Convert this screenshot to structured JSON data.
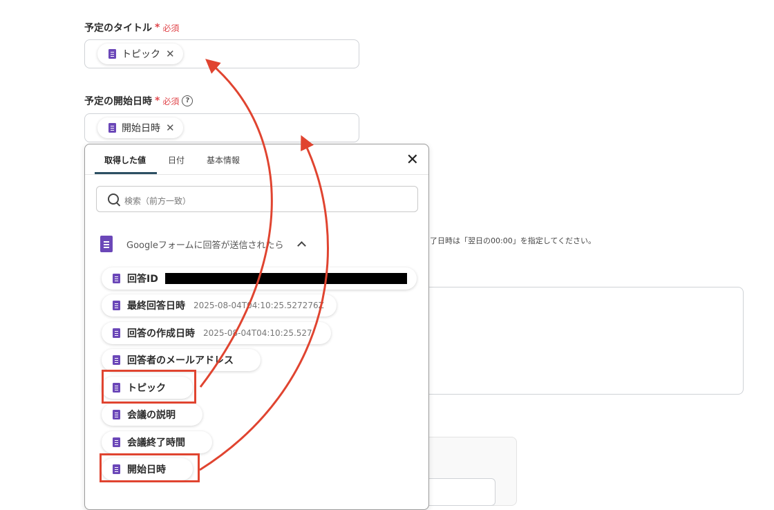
{
  "fields": {
    "title_label": "予定のタイトル",
    "title_required": "必須",
    "title_chip": "トピック",
    "start_label": "予定の開始日時",
    "start_required": "必須",
    "start_chip": "開始日時",
    "help_glyph": "?"
  },
  "popup": {
    "tabs": [
      "取得した値",
      "日付",
      "基本情報"
    ],
    "search_placeholder": "検索（前方一致）",
    "group_title": "Googleフォームに回答が送信されたら",
    "items": [
      {
        "label": "回答ID",
        "value": ""
      },
      {
        "label": "最終回答日時",
        "value": "2025-08-04T04:10:25.527276Z"
      },
      {
        "label": "回答の作成日時",
        "value": "2025-08-04T04:10:25.527"
      },
      {
        "label": "回答者のメールアドレス",
        "value": ""
      },
      {
        "label": "トピック",
        "value": ""
      },
      {
        "label": "会議の説明",
        "value": ""
      },
      {
        "label": "会議終了時間",
        "value": ""
      },
      {
        "label": "開始日時",
        "value": ""
      }
    ]
  },
  "background": {
    "note": "了日時は「翌日の00:00」を指定してください。"
  },
  "colors": {
    "accent_red": "#e04430",
    "doc_icon": "#6b47b8",
    "required": "#e0464b",
    "tab_underline": "#2c4f63"
  }
}
